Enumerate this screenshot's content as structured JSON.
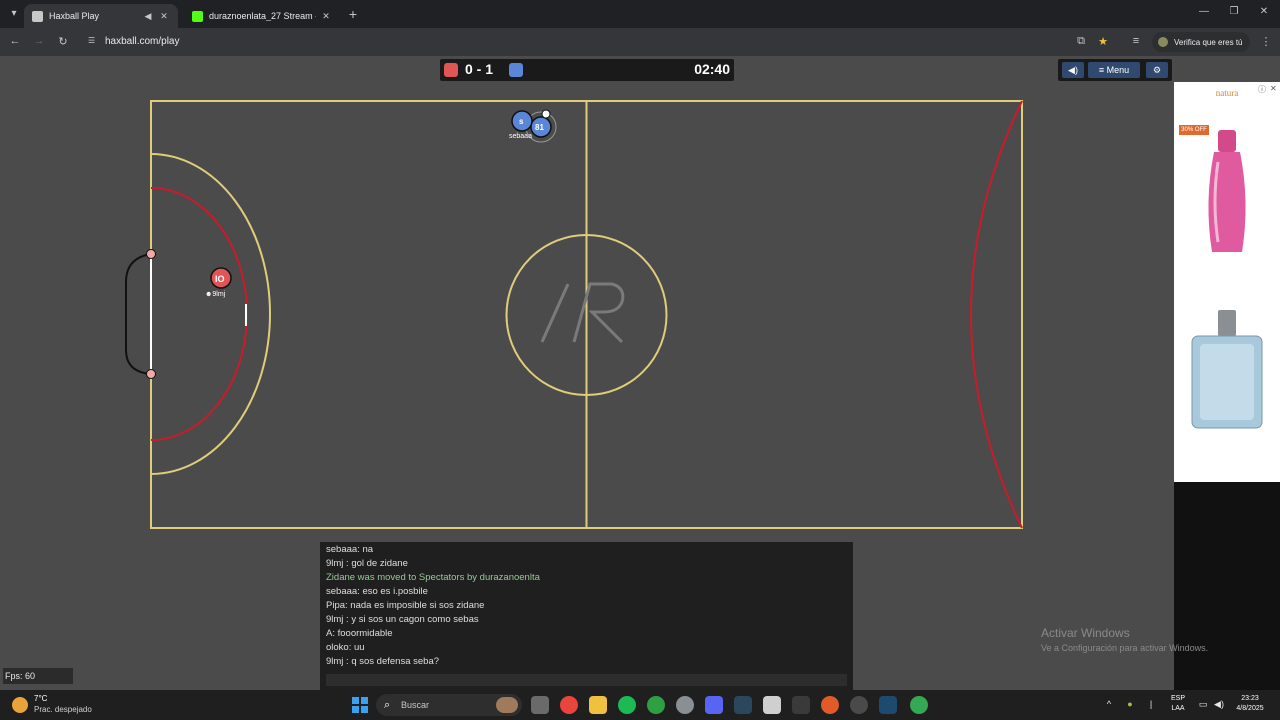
{
  "browser": {
    "tabs": [
      {
        "title": "Haxball Play",
        "active": true
      },
      {
        "title": "duraznoenlata_27 Stream - Wat",
        "active": false
      }
    ],
    "url": "haxball.com/play",
    "verify_label": "Verifica que eres tú"
  },
  "game": {
    "score": "0 - 1",
    "clock": "02:40",
    "red_color": "#e05656",
    "blue_color": "#5b86d8",
    "menu_label": "Menu",
    "players": [
      {
        "number": "IO",
        "team": "red",
        "name": "9lmj"
      },
      {
        "number": "81",
        "team": "blue",
        "name": "sebaaa"
      },
      {
        "number": "s",
        "team": "blue",
        "name": ""
      }
    ],
    "fps": "Fps: 60"
  },
  "chat": {
    "lines": [
      {
        "text": "sebaaa: na",
        "kind": "msg"
      },
      {
        "text": "9lmj : gol de zidane",
        "kind": "msg"
      },
      {
        "text": "Zidane was moved to Spectators by durazanoenlta",
        "kind": "notice"
      },
      {
        "text": "sebaaa: eso es i.posbile",
        "kind": "msg"
      },
      {
        "text": "Pipa: nada es imposible si sos zidane",
        "kind": "msg"
      },
      {
        "text": "9lmj : y si sos un cagon como sebas",
        "kind": "msg"
      },
      {
        "text": "A: fooormidable",
        "kind": "msg"
      },
      {
        "text": "oloko: uu",
        "kind": "msg"
      },
      {
        "text": "9lmj : q sos defensa seba?",
        "kind": "msg"
      }
    ]
  },
  "ad": {
    "brand": "natura",
    "badge": "30% OFF"
  },
  "watermark": {
    "line1": "Activar Windows",
    "line2": "Ve a Configuración para activar Windows."
  },
  "taskbar": {
    "weather_temp": "7°C",
    "weather_desc": "Prac. despejado",
    "search_placeholder": "Buscar",
    "lang1": "ESP",
    "lang2": "LAA",
    "time": "23:23",
    "date": "4/8/2025"
  }
}
